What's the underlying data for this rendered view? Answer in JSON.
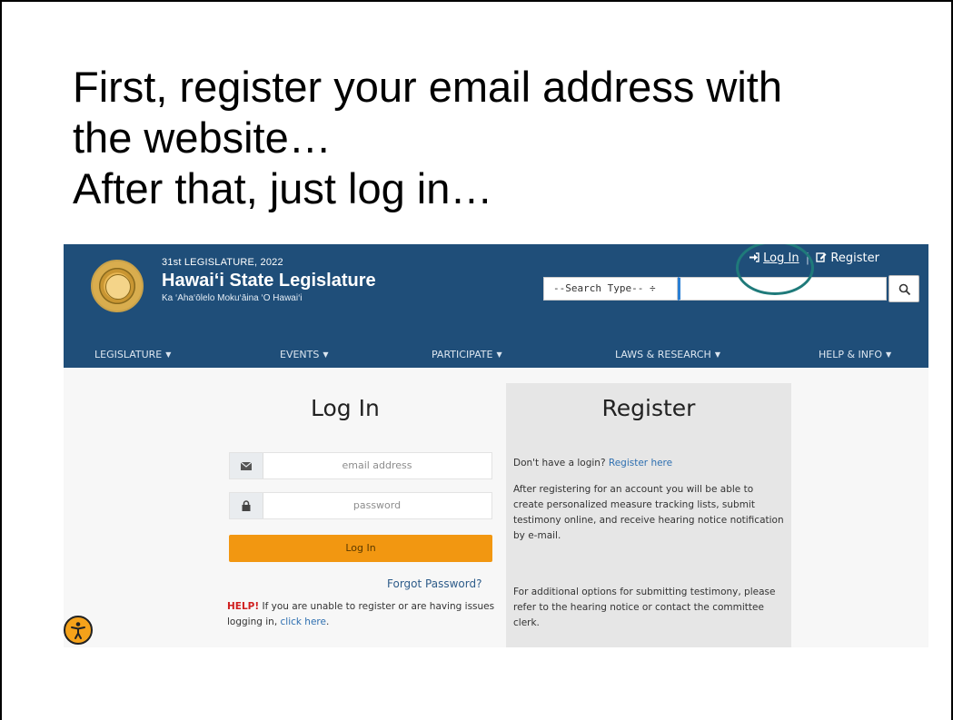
{
  "slide": {
    "title_lines": [
      "First, register your email address with",
      "the website…",
      "After that, just log in…"
    ]
  },
  "header": {
    "legislature_year": "31st LEGISLATURE, 2022",
    "legislature_name": "Hawai‘i State Legislature",
    "legislature_subtitle": "Ka ‘Aha‘ōlelo Moku‘āina ‘O Hawai‘i",
    "login_link": "Log In",
    "register_link": "Register",
    "search_type_select": "--Search Type-- ÷"
  },
  "nav": {
    "items": [
      "LEGISLATURE",
      "EVENTS",
      "PARTICIPATE",
      "LAWS & RESEARCH",
      "HELP & INFO"
    ]
  },
  "login": {
    "title": "Log In",
    "email_placeholder": "email address",
    "password_placeholder": "password",
    "button_label": "Log In",
    "forgot_link": "Forgot Password?",
    "help_prefix": "HELP!",
    "help_text": " If you are unable to register or are having issues logging in, ",
    "help_link": "click here",
    "help_suffix": "."
  },
  "register": {
    "title": "Register",
    "intro_text": "Don't have a login? ",
    "intro_link": "Register here",
    "paragraph1": "After registering for an account you will be able to create personalized measure tracking lists, submit testimony online, and receive hearing notice notification by e-mail.",
    "paragraph2": "For additional options for submitting testimony, please refer to the hearing notice or contact the committee clerk."
  },
  "icons": {
    "login": "sign-in-icon",
    "register": "edit-icon",
    "search": "search-icon",
    "email": "envelope-icon",
    "password": "lock-icon",
    "accessibility": "accessibility-icon"
  },
  "colors": {
    "header_bg": "#1f4e79",
    "login_button": "#f29711",
    "highlight_circle": "#1f7a7a",
    "link": "#2e6fb0",
    "help_red": "#d01f1f"
  }
}
